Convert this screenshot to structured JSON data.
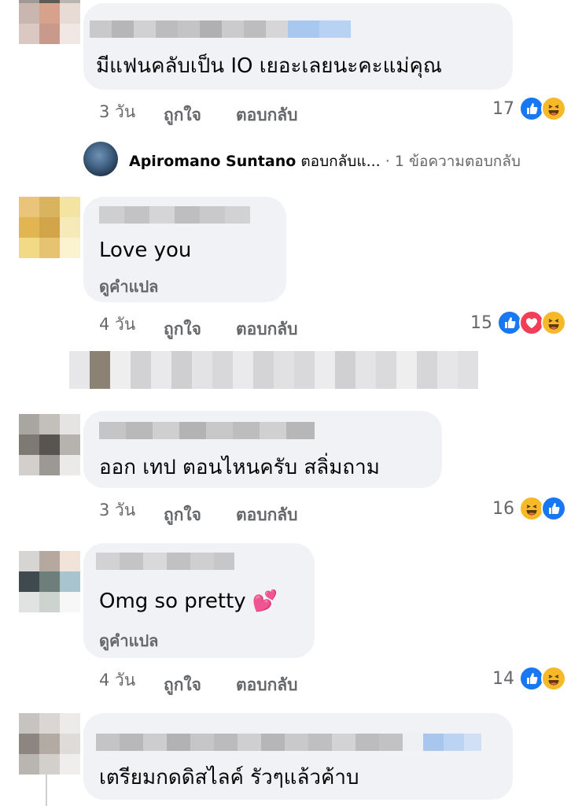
{
  "comments": [
    {
      "text": "มีแฟนคลับเป็น IO เยอะเลยนะคะแม่คุณ",
      "time": "3 วัน",
      "like_label": "ถูกใจ",
      "reply_label": "ตอบกลับ",
      "reaction_count": "17",
      "reactions": [
        "like-icon",
        "haha-icon"
      ]
    },
    {
      "text": "Love you",
      "translate_label": "ดูคำแปล",
      "time": "4 วัน",
      "like_label": "ถูกใจ",
      "reply_label": "ตอบกลับ",
      "reaction_count": "15",
      "reactions": [
        "like-icon",
        "love-icon",
        "haha-icon"
      ]
    },
    {
      "text": "ออก เทป ตอนไหนครับ สลิ่มถาม",
      "time": "3 วัน",
      "like_label": "ถูกใจ",
      "reply_label": "ตอบกลับ",
      "reaction_count": "16",
      "reactions": [
        "haha-icon",
        "like-icon"
      ]
    },
    {
      "text": "Omg so pretty 💕",
      "translate_label": "ดูคำแปล",
      "time": "4 วัน",
      "like_label": "ถูกใจ",
      "reply_label": "ตอบกลับ",
      "reaction_count": "14",
      "reactions": [
        "like-icon",
        "haha-icon"
      ]
    },
    {
      "text": "เตรียมกดดิสไลค์ รัวๆแล้วค้าบ"
    }
  ],
  "reply_preview": {
    "name": "Apiromano Suntano",
    "action": "ตอบกลับแ...",
    "separator": "·",
    "replies": "1 ข้อความตอบกลับ"
  },
  "colors": {
    "bubble": "#f0f2f5",
    "meta_text": "#65676b",
    "like": "#1877f2",
    "love": "#f33e58",
    "haha": "#f7b928"
  }
}
